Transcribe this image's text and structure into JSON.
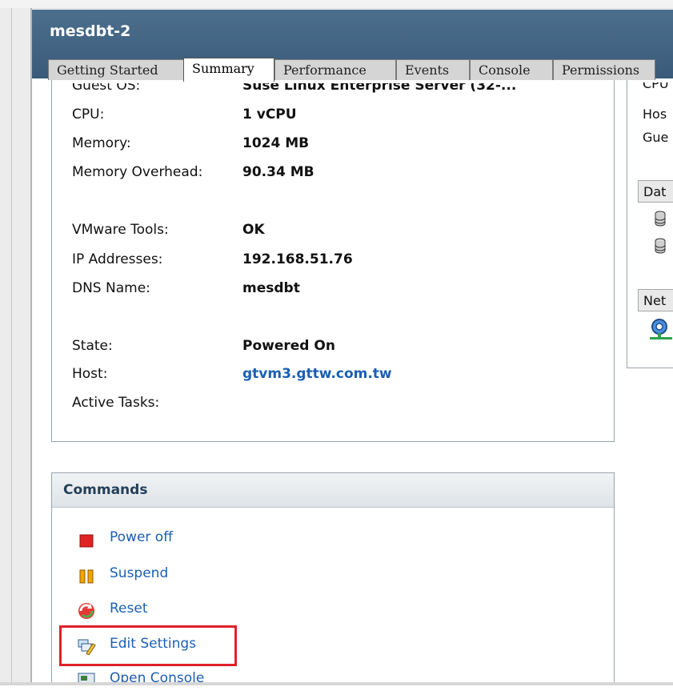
{
  "vm": {
    "title": "mesdbt-2"
  },
  "tabs": [
    {
      "label": "Getting Started",
      "active": false
    },
    {
      "label": "Summary",
      "active": true
    },
    {
      "label": "Performance",
      "active": false
    },
    {
      "label": "Events",
      "active": false
    },
    {
      "label": "Console",
      "active": false
    },
    {
      "label": "Permissions",
      "active": false
    }
  ],
  "general": {
    "guest_os_label": "Guest OS:",
    "guest_os_value": "Suse Linux Enterprise Server (32-...",
    "cpu_label": "CPU:",
    "cpu_value": "1 vCPU",
    "memory_label": "Memory:",
    "memory_value": "1024 MB",
    "overhead_label": "Memory Overhead:",
    "overhead_value": "90.34 MB",
    "tools_label": "VMware Tools:",
    "tools_value": "OK",
    "ip_label": "IP Addresses:",
    "ip_value": "192.168.51.76",
    "dns_label": "DNS Name:",
    "dns_value": "mesdbt",
    "state_label": "State:",
    "state_value": "Powered On",
    "host_label": "Host:",
    "host_value": "gtvm3.gttw.com.tw",
    "tasks_label": "Active Tasks:"
  },
  "resources": {
    "cpu_label": "CPU",
    "host_label": "Hos",
    "guest_label": "Gue",
    "datastore_header": "Dat",
    "network_header": "Net"
  },
  "commands": {
    "title": "Commands",
    "items": [
      {
        "label": "Power off",
        "icon": "power-off-icon"
      },
      {
        "label": "Suspend",
        "icon": "suspend-icon"
      },
      {
        "label": "Reset",
        "icon": "reset-icon"
      },
      {
        "label": "Edit Settings",
        "icon": "edit-settings-icon"
      },
      {
        "label": "Open Console",
        "icon": "open-console-icon"
      }
    ]
  },
  "colors": {
    "header": "#3e5f7e",
    "link": "#1a5fb4",
    "highlight": "#e0202a"
  }
}
